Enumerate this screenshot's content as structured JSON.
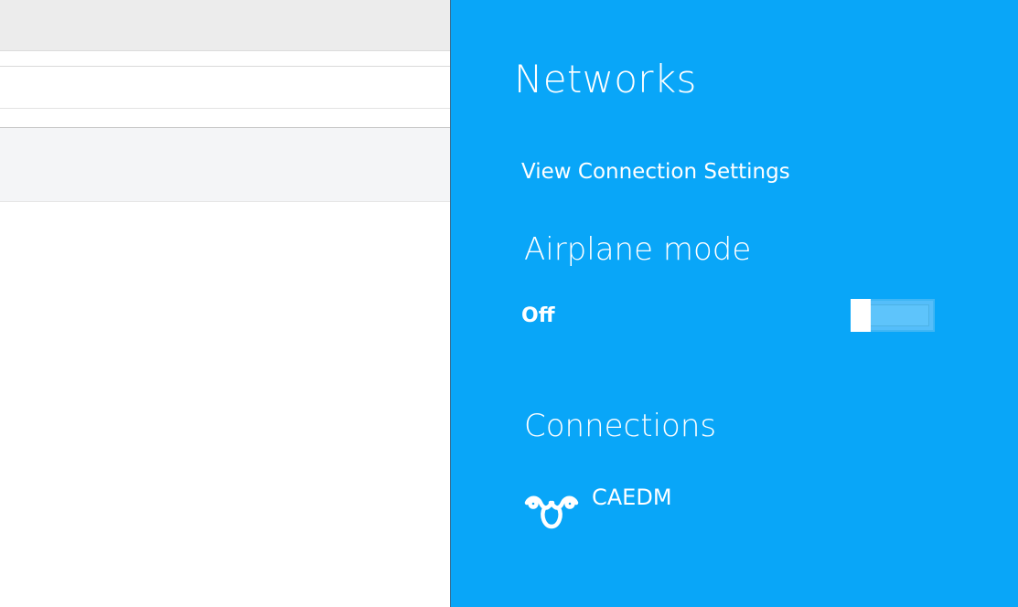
{
  "panel": {
    "title": "Networks",
    "view_settings_label": "View Connection Settings",
    "airplane": {
      "heading": "Airplane mode",
      "state_label": "Off",
      "enabled": false
    },
    "connections": {
      "heading": "Connections",
      "items": [
        {
          "name": "CAEDM",
          "icon": "wifi-network-icon"
        }
      ]
    },
    "accent_color": "#09a6f8"
  }
}
